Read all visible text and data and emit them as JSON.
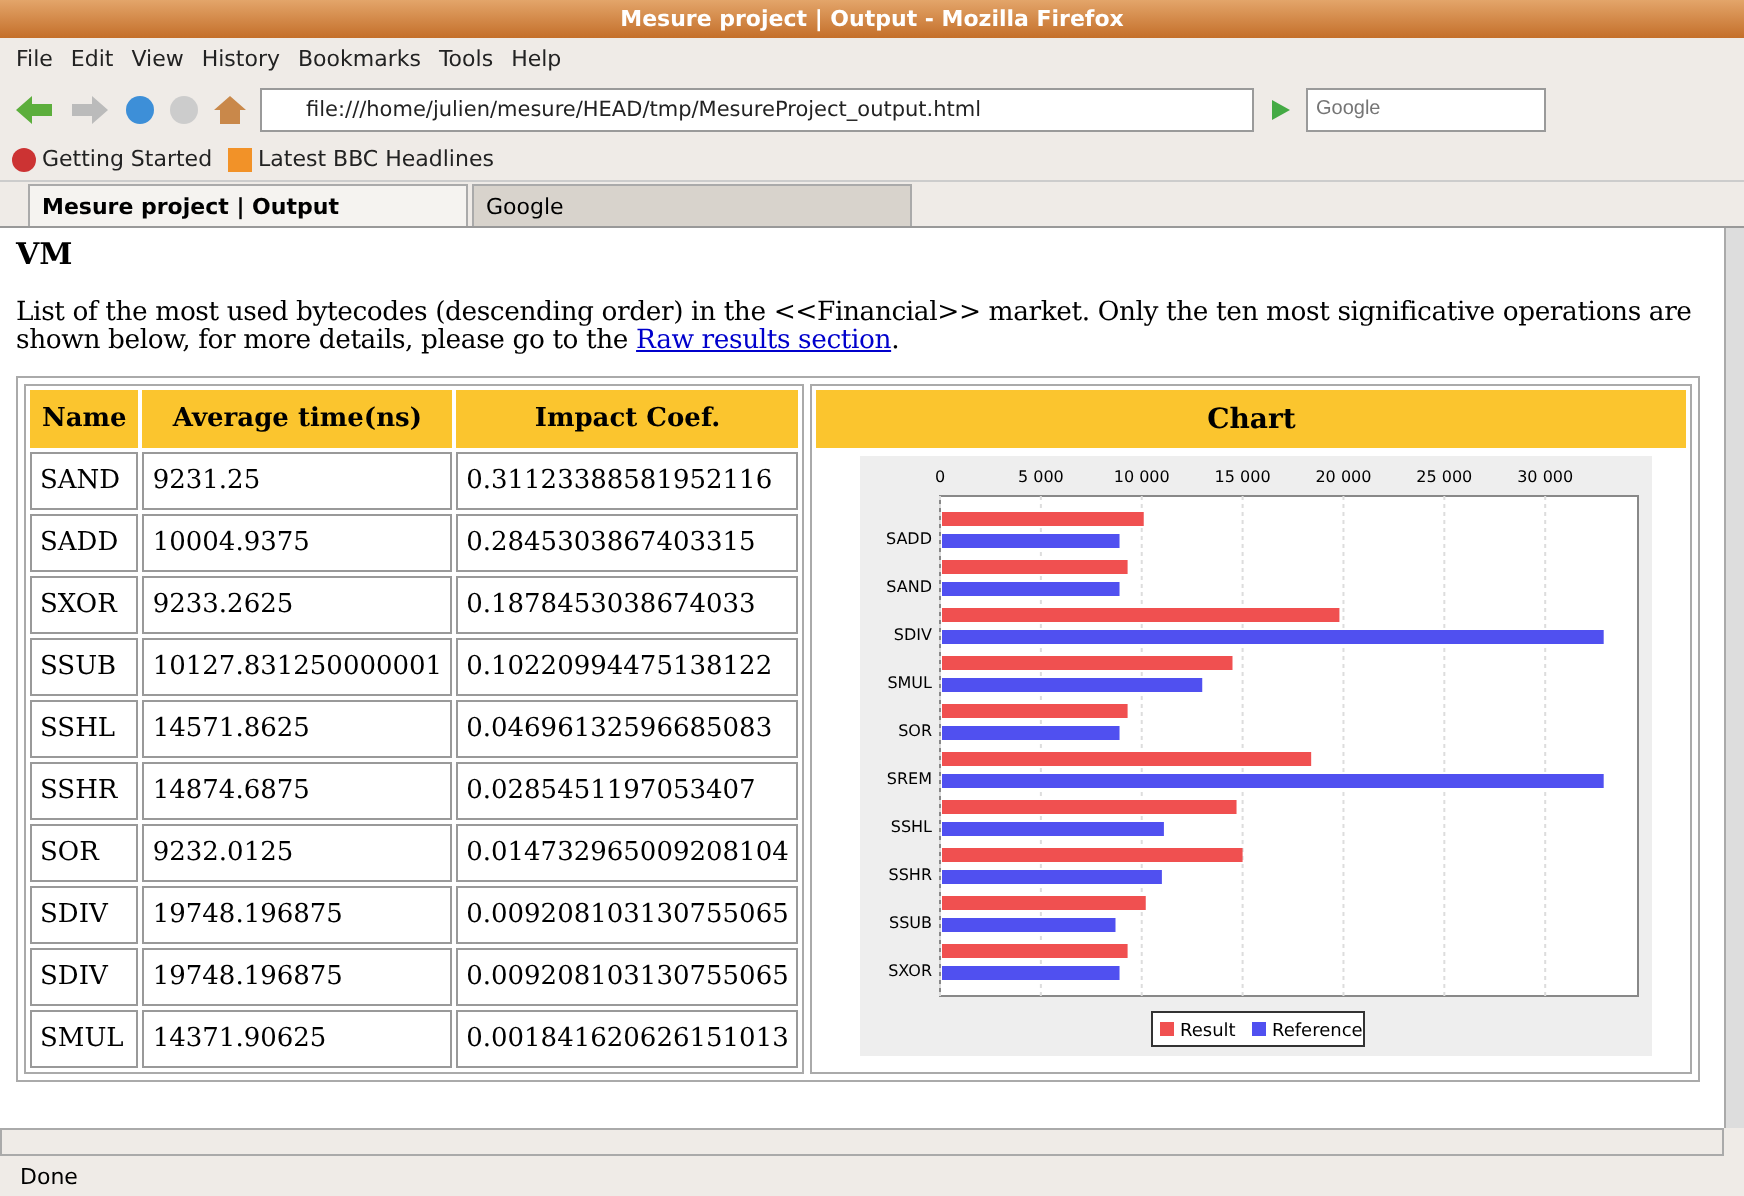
{
  "window": {
    "title": "Mesure project | Output - Mozilla Firefox"
  },
  "menu": [
    "File",
    "Edit",
    "View",
    "History",
    "Bookmarks",
    "Tools",
    "Help"
  ],
  "address": {
    "value": "file:///home/julien/mesure/HEAD/tmp/MesureProject_output.html"
  },
  "search": {
    "placeholder": "Google"
  },
  "bookmarks": [
    {
      "label": "Getting Started",
      "kind": "firefox"
    },
    {
      "label": "Latest BBC Headlines",
      "kind": "rss"
    }
  ],
  "tabs": [
    {
      "label": "Mesure project | Output",
      "selected": true
    },
    {
      "label": "Google",
      "selected": false
    }
  ],
  "page": {
    "heading": "VM",
    "intro": "List of the most used bytecodes (descending order) in the <<Financial>> market. Only the ten most significative operations are shown below, for more details, please go to the ",
    "link": "Raw results section",
    "after": "."
  },
  "table": {
    "columns": [
      "Name",
      "Average time(ns)",
      "Impact Coef."
    ],
    "rows": [
      [
        "SAND",
        "9231.25",
        "0.31123388581952116"
      ],
      [
        "SADD",
        "10004.9375",
        "0.2845303867403315"
      ],
      [
        "SXOR",
        "9233.2625",
        "0.1878453038674033"
      ],
      [
        "SSUB",
        "10127.831250000001",
        "0.10220994475138122"
      ],
      [
        "SSHL",
        "14571.8625",
        "0.04696132596685083"
      ],
      [
        "SSHR",
        "14874.6875",
        "0.0285451197053407"
      ],
      [
        "SOR",
        "9232.0125",
        "0.014732965009208104"
      ],
      [
        "SDIV",
        "19748.196875",
        "0.009208103130755065"
      ],
      [
        "SDIV",
        "19748.196875",
        "0.009208103130755065"
      ],
      [
        "SMUL",
        "14371.90625",
        "0.001841620626151013"
      ]
    ]
  },
  "chart_panel": {
    "title": "Chart",
    "chart_data": {
      "type": "bar",
      "orientation": "horizontal",
      "categories": [
        "SADD",
        "SAND",
        "SDIV",
        "SMUL",
        "SOR",
        "SREM",
        "SSHL",
        "SSHR",
        "SSUB",
        "SXOR"
      ],
      "series": [
        {
          "name": "Result",
          "color": "#f05050",
          "values": [
            10000,
            9200,
            19700,
            14400,
            9200,
            18300,
            14600,
            14900,
            10100,
            9200
          ]
        },
        {
          "name": "Reference",
          "color": "#5050f0",
          "values": [
            8800,
            8800,
            32800,
            12900,
            8800,
            32800,
            11000,
            10900,
            8600,
            8800
          ]
        }
      ],
      "grid": true,
      "legend": "bottom",
      "xlim": [
        0,
        34600
      ],
      "xticks": [
        {
          "value": 0,
          "label": "0"
        },
        {
          "value": 5000,
          "label": "5 000"
        },
        {
          "value": 10000,
          "label": "10 000"
        },
        {
          "value": 15000,
          "label": "15 000"
        },
        {
          "value": 20000,
          "label": "20 000"
        },
        {
          "value": 25000,
          "label": "25 000"
        },
        {
          "value": 30000,
          "label": "30 000"
        }
      ]
    }
  },
  "status_bar": "Done"
}
